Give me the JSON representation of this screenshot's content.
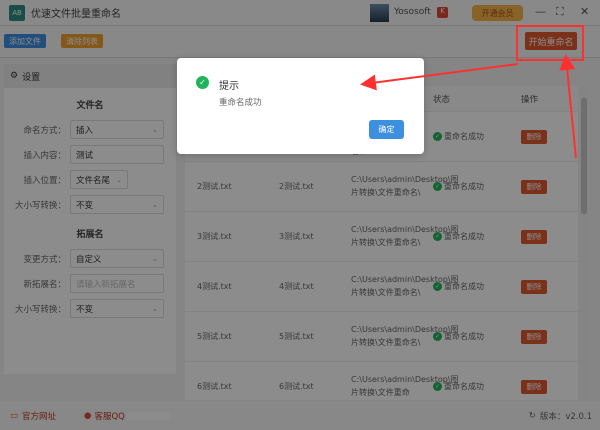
{
  "app": {
    "title": "优速文件批量重命名",
    "user": "Yososoft",
    "vip": "开通会员",
    "logo_text": "AB"
  },
  "toolbar": {
    "add_files": "添加文件",
    "clear_list": "清除列表",
    "start": "开始重命名"
  },
  "settings": {
    "title": "设置",
    "filename_section": "文件名",
    "fields": [
      {
        "label": "命名方式：",
        "value": "插入"
      },
      {
        "label": "插入内容：",
        "value": "测试"
      },
      {
        "label": "插入位置：",
        "value": "文件名尾"
      },
      {
        "label": "大小写转换：",
        "value": "不变"
      }
    ],
    "ext_section": "拓展名",
    "ext_fields": [
      {
        "label": "变更方式：",
        "value": "自定义"
      },
      {
        "label": "新拓展名：",
        "placeholder": "请输入新拓展名"
      },
      {
        "label": "大小写转换：",
        "value": "不变"
      }
    ]
  },
  "table": {
    "headers": {
      "status": "状态",
      "action": "操作"
    },
    "rows": [
      {
        "old": "",
        "new": "",
        "path": "名\\",
        "status": "重命名成功",
        "action": "删除"
      },
      {
        "old": "2测试.txt",
        "new": "2测试.txt",
        "path": "C:\\Users\\admin\\Desktop\\图片转换\\文件重命名\\",
        "status": "重命名成功",
        "action": "删除"
      },
      {
        "old": "3测试.txt",
        "new": "3测试.txt",
        "path": "C:\\Users\\admin\\Desktop\\图片转换\\文件重命名\\",
        "status": "重命名成功",
        "action": "删除"
      },
      {
        "old": "4测试.txt",
        "new": "4测试.txt",
        "path": "C:\\Users\\admin\\Desktop\\图片转换\\文件重命名\\",
        "status": "重命名成功",
        "action": "删除"
      },
      {
        "old": "5测试.txt",
        "new": "5测试.txt",
        "path": "C:\\Users\\admin\\Desktop\\图片转换\\文件重命名\\",
        "status": "重命名成功",
        "action": "删除"
      },
      {
        "old": "6测试.txt",
        "new": "6测试.txt",
        "path": "C:\\Users\\admin\\Desktop\\图片转换\\文件重命",
        "status": "重命名成功",
        "action": "删除"
      }
    ]
  },
  "footer": {
    "website": "官方网址",
    "qq": "客服QQ",
    "version": "版本：v2.0.1"
  },
  "dialog": {
    "title": "提示",
    "message": "重命名成功",
    "ok": "确定"
  },
  "colors": {
    "accent": "#3d8fe0",
    "danger": "#e0582f",
    "success": "#21b35b",
    "annotation": "#ff3030"
  }
}
